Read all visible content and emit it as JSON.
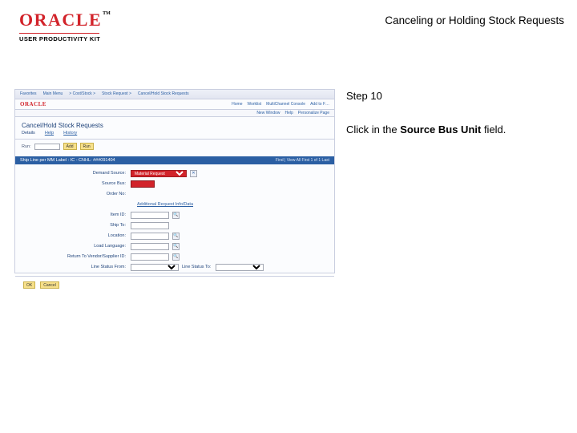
{
  "header": {
    "logo_text": "ORACLE",
    "logo_tm": "TM",
    "upk": "USER PRODUCTIVITY KIT",
    "doc_title": "Canceling or Holding Stock Requests"
  },
  "instructions": {
    "step_label": "Step 10",
    "text_before": "Click in the ",
    "text_bold": "Source Bus Unit",
    "text_after": " field."
  },
  "app": {
    "nav": [
      "Favorites",
      "Main Menu",
      "> Cost/Stock >",
      "Stock Request >",
      "Cancel/Hold Stock Requests"
    ],
    "brand": "ORACLE",
    "rightlinks": [
      "Home",
      "Worklist",
      "MultiChannel Console",
      "Add to F…"
    ],
    "subbar": [
      "New Window",
      "Help",
      "Personalize Page"
    ],
    "page_title": "Cancel/Hold Stock Requests",
    "tabs": {
      "active": "Details",
      "t2": "Help",
      "t3": "History"
    },
    "run": {
      "label": "Run:",
      "btn1": "Add",
      "btn2": "Run"
    },
    "panel_title": "Ship Line per MM Label : IC - CNHL: ###091404",
    "panel_utils": "Find | View All   First  1 of 1  Last",
    "form": {
      "demand_source_label": "Demand Source:",
      "demand_source_value": "Material Request",
      "source_bus_unit_label": "Source Bus:",
      "source_bus_unit_value": "",
      "order_no_label": "Order No:",
      "line_label": "Additional Request Info/Data",
      "item_id_label": "Item ID:",
      "ship_to_label": "Ship To:",
      "location_label": "Location:",
      "sched_lang_label": "Load Language:",
      "return_vendor_label": "Return To Vendor/Supplier ID:",
      "line_status_left_label": "Line Status From:",
      "line_status_right_label": "Line Status To:"
    },
    "buttons": {
      "ok": "OK",
      "cancel": "Cancel"
    }
  }
}
